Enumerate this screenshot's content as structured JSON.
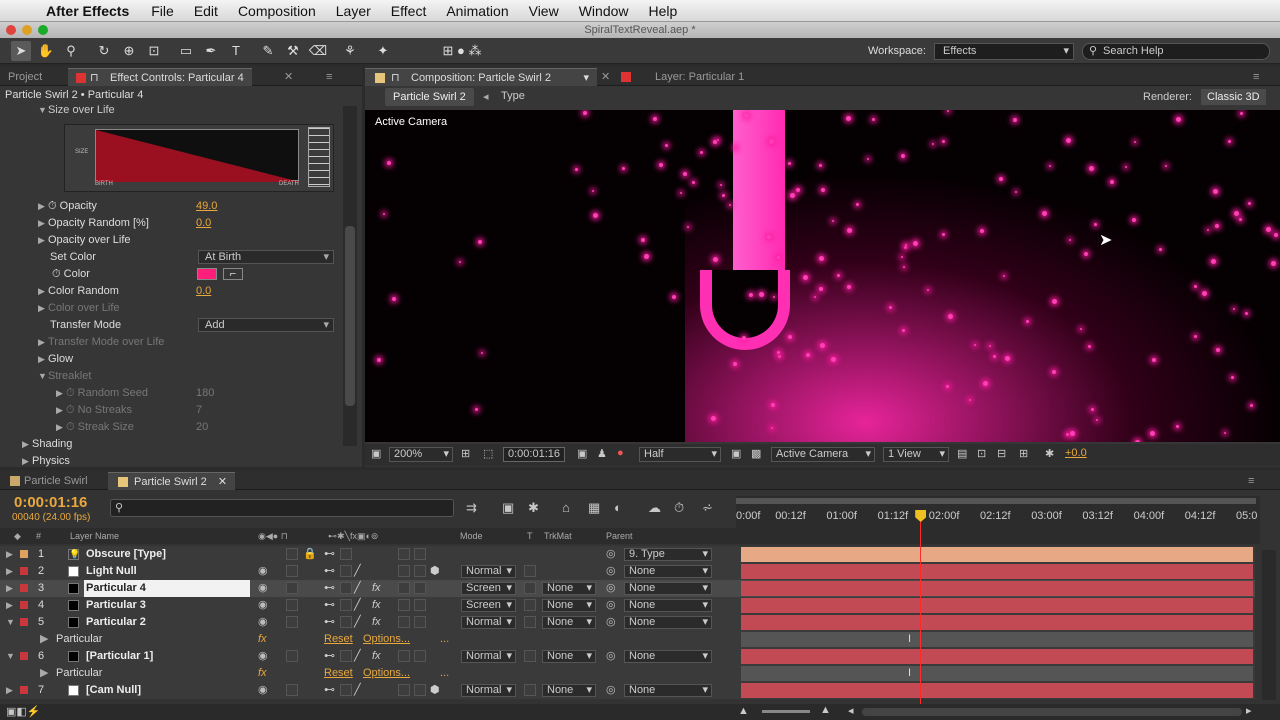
{
  "menubar": {
    "app": "After Effects",
    "items": [
      "File",
      "Edit",
      "Composition",
      "Layer",
      "Effect",
      "Animation",
      "View",
      "Window",
      "Help"
    ]
  },
  "window_title": "SpiralTextReveal.aep *",
  "toolbar": {
    "workspace_label": "Workspace:",
    "workspace_value": "Effects",
    "search_placeholder": "Search Help"
  },
  "left_panel": {
    "tabs": [
      "Project",
      "Effect Controls: Particular 4"
    ],
    "breadcrumb": "Particle Swirl 2 • Particular 4",
    "size_over_life": "Size over Life",
    "graph": {
      "y_label": "SIZE",
      "x_start": "BIRTH",
      "x_end": "DEATH"
    },
    "rows": [
      {
        "label": "Opacity",
        "value": "49.0"
      },
      {
        "label": "Opacity Random [%]",
        "value": "0.0"
      },
      {
        "label": "Opacity over Life"
      },
      {
        "label": "Set Color",
        "dropdown": "At Birth"
      },
      {
        "label": "Color"
      },
      {
        "label": "Color Random",
        "value": "0.0"
      },
      {
        "label": "Color over Life"
      },
      {
        "label": "Transfer Mode",
        "dropdown": "Add"
      },
      {
        "label": "Transfer Mode over Life"
      },
      {
        "label": "Glow"
      },
      {
        "label": "Streaklet"
      },
      {
        "label": "Random Seed",
        "value": "180"
      },
      {
        "label": "No Streaks",
        "value": "7"
      },
      {
        "label": "Streak Size",
        "value": "20"
      },
      {
        "label": "Shading"
      },
      {
        "label": "Physics"
      }
    ]
  },
  "colors": {
    "accent_orange": "#e8a83e",
    "particle_pink": "#ff1aa0",
    "color_swatch": "#ff1f7a",
    "label_red": "#c8373c",
    "playhead": "#ff2a2a",
    "bar_red": "#c24a55",
    "bar_peach": "#e7a886"
  },
  "comp_panel": {
    "tabs": [
      "Composition: Particle Swirl 2",
      "Layer: Particular 1"
    ],
    "crumbs": [
      "Particle Swirl 2",
      "Type"
    ],
    "renderer_label": "Renderer:",
    "renderer_value": "Classic 3D",
    "viewer_label": "Active Camera",
    "bottom": {
      "zoom": "200%",
      "time": "0:00:01:16",
      "resolution": "Half",
      "camera": "Active Camera",
      "views": "1 View",
      "exposure": "+0.0"
    }
  },
  "timeline": {
    "tabs": [
      "Particle Swirl",
      "Particle Swirl 2"
    ],
    "timecode": "0:00:01:16",
    "frames": "00040 (24.00 fps)",
    "search_placeholder": "",
    "headers": {
      "name": "Layer Name",
      "mode": "Mode",
      "t": "T",
      "trkmat": "TrkMat",
      "parent": "Parent"
    },
    "ruler": [
      "0:00f",
      "00:12f",
      "01:00f",
      "01:12f",
      "02:00f",
      "02:12f",
      "03:00f",
      "03:12f",
      "04:00f",
      "04:12f",
      "05:0"
    ],
    "playhead_fraction": 0.342,
    "layers": [
      {
        "num": "1",
        "name": "Obscure [Type]",
        "mode": "",
        "trkmat": "",
        "parent": "9. Type"
      },
      {
        "num": "2",
        "name": "Light Null",
        "mode": "Normal",
        "trkmat": "",
        "parent": "None"
      },
      {
        "num": "3",
        "name": "Particular 4",
        "mode": "Screen",
        "trkmat": "None",
        "parent": "None"
      },
      {
        "num": "4",
        "name": "Particular 3",
        "mode": "Screen",
        "trkmat": "None",
        "parent": "None"
      },
      {
        "num": "5",
        "name": "Particular 2",
        "mode": "Normal",
        "trkmat": "None",
        "parent": "None"
      },
      {
        "sub": "Particular",
        "reset": "Reset",
        "options": "Options...",
        "dots": "..."
      },
      {
        "num": "6",
        "name": "[Particular 1]",
        "mode": "Normal",
        "trkmat": "None",
        "parent": "None"
      },
      {
        "sub": "Particular",
        "reset": "Reset",
        "options": "Options...",
        "dots": "..."
      },
      {
        "num": "7",
        "name": "[Cam Null]",
        "mode": "Normal",
        "trkmat": "None",
        "parent": "None"
      }
    ]
  }
}
